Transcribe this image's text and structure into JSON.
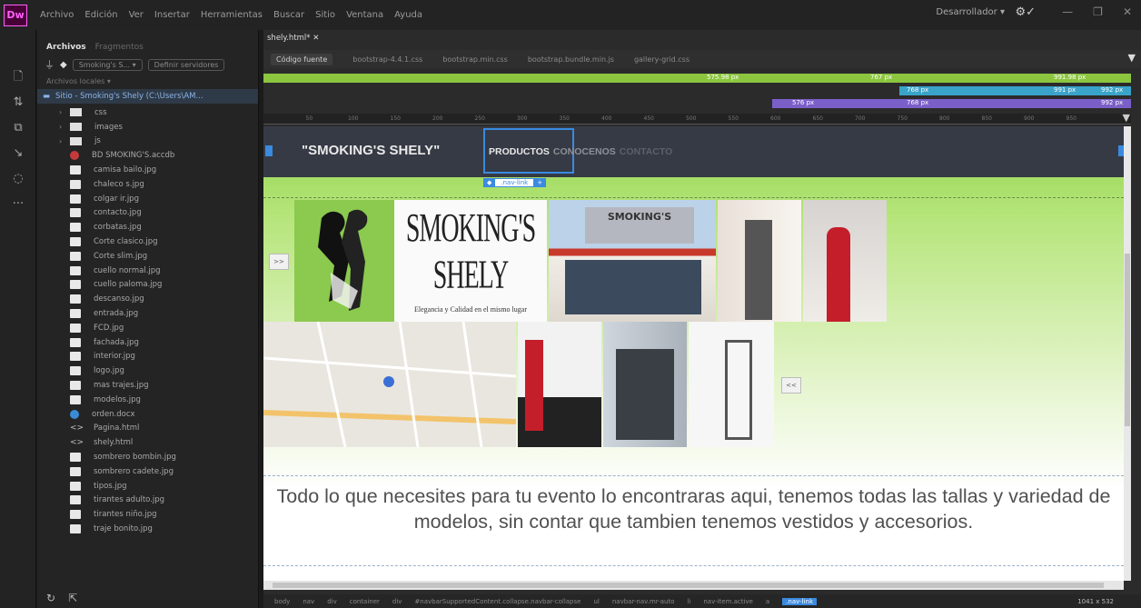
{
  "app": {
    "logo": "Dw"
  },
  "menu": [
    "Archivo",
    "Edición",
    "Ver",
    "Insertar",
    "Herramientas",
    "Buscar",
    "Sitio",
    "Ventana",
    "Ayuda"
  ],
  "workspace": "Desarrollador",
  "files_panel": {
    "tabs": [
      "Archivos",
      "Fragmentos"
    ],
    "site_select": "Smoking's S...",
    "view_select": "Definir servidores",
    "local_label": "Archivos locales",
    "site_root": "Sitio - Smoking's Shely (C:\\Users\\AM...",
    "items": [
      {
        "name": "css",
        "type": "folder"
      },
      {
        "name": "images",
        "type": "folder"
      },
      {
        "name": "js",
        "type": "folder"
      },
      {
        "name": "BD SMOKING'S.accdb",
        "type": "acc"
      },
      {
        "name": "camisa bailo.jpg",
        "type": "img"
      },
      {
        "name": "chaleco s.jpg",
        "type": "img"
      },
      {
        "name": "colgar ir.jpg",
        "type": "img"
      },
      {
        "name": "contacto.jpg",
        "type": "img"
      },
      {
        "name": "corbatas.jpg",
        "type": "img"
      },
      {
        "name": "Corte clasico.jpg",
        "type": "img"
      },
      {
        "name": "Corte slim.jpg",
        "type": "img"
      },
      {
        "name": "cuello normal.jpg",
        "type": "img"
      },
      {
        "name": "cuello paloma.jpg",
        "type": "img"
      },
      {
        "name": "descanso.jpg",
        "type": "img"
      },
      {
        "name": "entrada.jpg",
        "type": "img"
      },
      {
        "name": "FCD.jpg",
        "type": "img"
      },
      {
        "name": "fachada.jpg",
        "type": "img"
      },
      {
        "name": "interior.jpg",
        "type": "img"
      },
      {
        "name": "logo.jpg",
        "type": "img"
      },
      {
        "name": "mas trajes.jpg",
        "type": "img"
      },
      {
        "name": "modelos.jpg",
        "type": "img"
      },
      {
        "name": "orden.docx",
        "type": "css"
      },
      {
        "name": "Pagina.html",
        "type": "code"
      },
      {
        "name": "shely.html",
        "type": "code"
      },
      {
        "name": "sombrero bombin.jpg",
        "type": "img"
      },
      {
        "name": "sombrero cadete.jpg",
        "type": "img"
      },
      {
        "name": "tipos.jpg",
        "type": "img"
      },
      {
        "name": "tirantes adulto.jpg",
        "type": "img"
      },
      {
        "name": "tirantes niño.jpg",
        "type": "img"
      },
      {
        "name": "traje bonito.jpg",
        "type": "img"
      }
    ]
  },
  "document": {
    "tab": "shely.html*",
    "related_files": [
      "Código fuente",
      "bootstrap-4.4.1.css",
      "bootstrap.min.css",
      "bootstrap.bundle.min.js",
      "gallery-grid.css"
    ],
    "media_queries": {
      "row1": [
        "575.98 px",
        "767 px",
        "991.98 px"
      ],
      "row2": [
        "768 px",
        "991 px",
        "992 px"
      ],
      "row3": [
        "576 px",
        "768 px",
        "992 px"
      ]
    },
    "ruler_ticks": [
      "50",
      "100",
      "150",
      "200",
      "250",
      "300",
      "350",
      "400",
      "450",
      "500",
      "550",
      "600",
      "650",
      "700",
      "750",
      "800",
      "850",
      "900",
      "950"
    ]
  },
  "page": {
    "brand": "\"SMOKING'S SHELY\"",
    "nav": [
      "PRODUCTOS",
      "CONOCENOS",
      "CONTACTO"
    ],
    "selected_tag": ".nav-link",
    "prev_label": ">>",
    "next_label": "<<",
    "logo_text": "SMOKING'S SHELY",
    "logo_sub": "Elegancia y Calidad en el mismo lugar",
    "store_sign": "SMOKING'S",
    "body_text": "Todo lo que necesites para tu evento lo encontraras aqui, tenemos todas las tallas y  variedad de modelos, sin contar que tambien tenemos vestidos y accesorios."
  },
  "status": {
    "breadcrumb": [
      "body",
      "nav",
      "div",
      "container",
      "div",
      "#navbarSupportedContent.collapse.navbar-collapse",
      "ul",
      "navbar-nav.mr-auto",
      "li",
      "nav-item.active",
      "a",
      ".nav-link"
    ],
    "resolution": "1041 x 532"
  },
  "colors": {
    "accent": "#3a8ae0",
    "canvas_green": "#8fd44a",
    "navbar": "#363a45"
  }
}
